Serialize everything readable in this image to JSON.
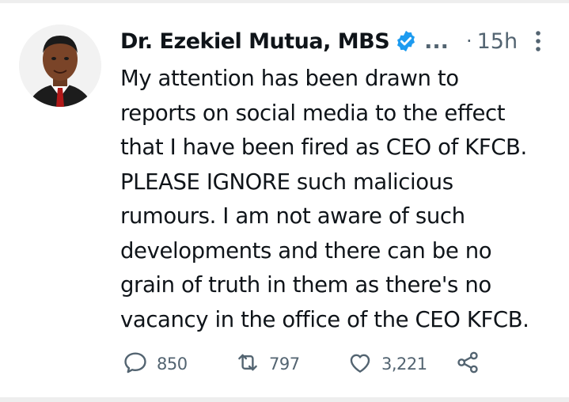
{
  "tweet": {
    "author": {
      "name": "Dr. Ezekiel Mutua, MBS",
      "truncation": "...",
      "verified_icon": "verified-badge-icon"
    },
    "separator": "·",
    "time": "15h",
    "more_icon": "more-vertical-icon",
    "text_lines": [
      "My attention has been drawn to",
      "reports on social media to the effect",
      "that I have been fired as CEO of KFCB.",
      "PLEASE IGNORE such malicious",
      "rumours. I am not aware of such",
      "developments and there can be no",
      "grain of truth in them as there's no",
      "vacancy in the office of the CEO KFCB."
    ],
    "actions": {
      "reply_count": "850",
      "retweet_count": "797",
      "like_count": "3,221"
    },
    "colors": {
      "verified": "#1d9bf0",
      "muted": "#536471",
      "text": "#0f1419"
    }
  }
}
